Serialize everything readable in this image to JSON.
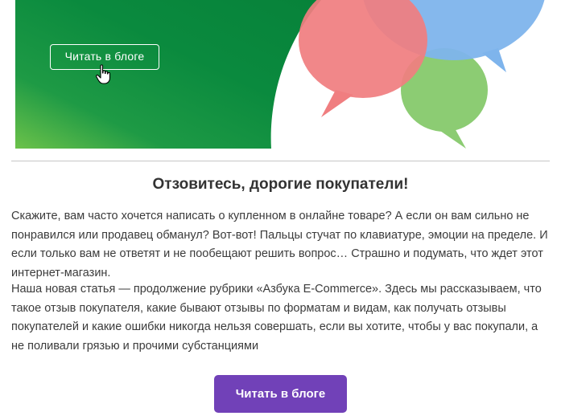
{
  "banner": {
    "button_label": "Читать в блоге",
    "colors": {
      "green_dark": "#0a8a3e",
      "green_light": "#5bbe4f",
      "bubble_red": "#f07e80",
      "bubble_blue": "#7eb4ec",
      "bubble_green": "#8ccc73"
    }
  },
  "article": {
    "title": "Отзовитесь, дорогие покупатели!",
    "paragraph_1": "Скажите, вам часто хочется написать о купленном в онлайне товаре? А если он вам сильно не понравился или продавец обманул? Вот-вот! Пальцы стучат по клавиатуре, эмоции на пределе. И если только вам не ответят и не пообещают решить вопрос… Страшно и подумать, что ждет этот интернет-магазин.",
    "paragraph_2": "Наша новая статья — продолжение рубрики «Азбука E-Commerce». Здесь мы рассказываем, что такое отзыв покупателя, какие бывают отзывы по форматам и видам, как получать отзывы покупателей и какие ошибки никогда нельзя совершать, если вы хотите, чтобы у вас покупали, а не поливали грязью и прочими субстанциями"
  },
  "cta": {
    "label": "Читать в блоге",
    "color": "#7141b8"
  }
}
